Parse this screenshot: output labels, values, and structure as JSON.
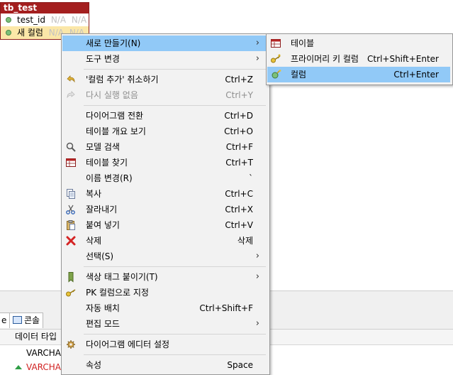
{
  "entity": {
    "title": "tb_test",
    "rows": [
      {
        "name": "test_id",
        "type": "N/A",
        "null": "N/A"
      },
      {
        "name": "새 컬럼",
        "type": "N/A",
        "null": "N/A"
      }
    ]
  },
  "bottom": {
    "tabs": [
      {
        "label": "e"
      },
      {
        "label": "콘솔",
        "icon": "console-icon"
      }
    ],
    "table": {
      "header": "데이터 타입",
      "rows": [
        {
          "value": "VARCHA",
          "color": "#000000"
        },
        {
          "value": "VARCHA",
          "color": "#d02020"
        }
      ]
    }
  },
  "menu": {
    "items": [
      {
        "label": "새로 만들기(N)",
        "shortcut": "",
        "submenu": true,
        "highlighted": true
      },
      {
        "label": "도구 변경",
        "shortcut": "",
        "submenu": true
      },
      {
        "label": "'컬럼 추가' 취소하기",
        "shortcut": "Ctrl+Z",
        "icon": "undo-icon"
      },
      {
        "label": "다시 실행 없음",
        "shortcut": "Ctrl+Y",
        "icon": "redo-icon",
        "disabled": true
      },
      {
        "label": "다이어그램 전환",
        "shortcut": "Ctrl+D"
      },
      {
        "label": "테이블 개요 보기",
        "shortcut": "Ctrl+O"
      },
      {
        "label": "모델 검색",
        "shortcut": "Ctrl+F",
        "icon": "search-icon"
      },
      {
        "label": "테이블 찾기",
        "shortcut": "Ctrl+T",
        "icon": "table-icon"
      },
      {
        "label": "이름 변경(R)",
        "shortcut": "`"
      },
      {
        "label": "복사",
        "shortcut": "Ctrl+C",
        "icon": "copy-icon"
      },
      {
        "label": "잘라내기",
        "shortcut": "Ctrl+X",
        "icon": "cut-icon"
      },
      {
        "label": "붙여 넣기",
        "shortcut": "Ctrl+V",
        "icon": "paste-icon"
      },
      {
        "label": "삭제",
        "shortcut": "삭제",
        "icon": "delete-icon"
      },
      {
        "label": "선택(S)",
        "shortcut": "",
        "submenu": true
      },
      {
        "label": "색상 태그 붙이기(T)",
        "shortcut": "",
        "submenu": true,
        "icon": "color-tag-icon"
      },
      {
        "label": "PK 컬럼으로 지정",
        "shortcut": "",
        "icon": "pk-icon"
      },
      {
        "label": "자동 배치",
        "shortcut": "Ctrl+Shift+F"
      },
      {
        "label": "편집 모드",
        "shortcut": "",
        "submenu": true
      },
      {
        "label": "다이어그램 에디터 설정",
        "shortcut": "",
        "icon": "gear-icon"
      },
      {
        "label": "속성",
        "shortcut": "Space"
      }
    ]
  },
  "submenu": {
    "items": [
      {
        "label": "테이블",
        "shortcut": "",
        "icon": "table-icon"
      },
      {
        "label": "프라이머리 키 컬럼",
        "shortcut": "Ctrl+Shift+Enter",
        "icon": "key-icon"
      },
      {
        "label": "컬럼",
        "shortcut": "Ctrl+Enter",
        "icon": "column-icon",
        "highlighted": true
      }
    ]
  }
}
